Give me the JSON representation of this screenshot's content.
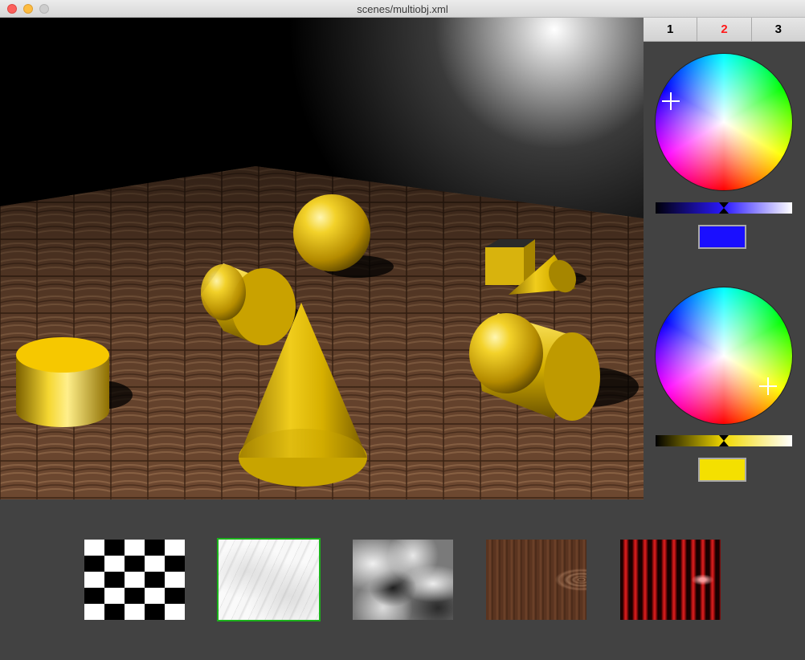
{
  "window": {
    "title": "scenes/multiobj.xml"
  },
  "side_panel": {
    "tabs": [
      {
        "label": "1",
        "active": false
      },
      {
        "label": "2",
        "active": true
      },
      {
        "label": "3",
        "active": false
      }
    ],
    "active_tab_color": "#ff1a1a",
    "color_picker_1": {
      "swatch_color": "#1a0fff",
      "ramp_from": "#000008",
      "ramp_mid": "#2a18ff",
      "ramp_to": "#ffffff",
      "ramp_level": 0.5
    },
    "color_picker_2": {
      "swatch_color": "#f4e000",
      "ramp_from": "#000000",
      "ramp_mid": "#f2d900",
      "ramp_to": "#ffffff",
      "ramp_level": 0.5
    }
  },
  "scene": {
    "objects": [
      "sphere",
      "cube",
      "cone",
      "cone",
      "cylinder",
      "cylinder",
      "cylinder"
    ],
    "material_color": "#e6b800",
    "floor_texture": "wood-tiles"
  },
  "textures": [
    {
      "name": "checkerboard",
      "selected": false
    },
    {
      "name": "marble",
      "selected": true
    },
    {
      "name": "clouds",
      "selected": false
    },
    {
      "name": "wood",
      "selected": false
    },
    {
      "name": "rings",
      "selected": false
    }
  ],
  "selection_color": "#1cb11c"
}
